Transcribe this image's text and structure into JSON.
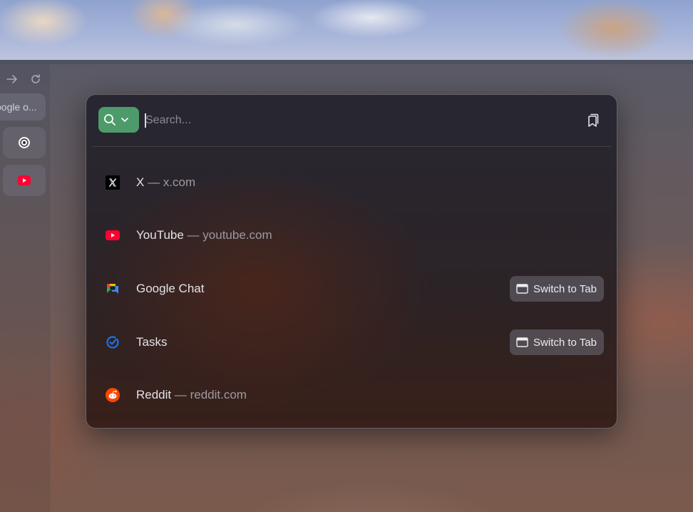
{
  "sidebar": {
    "url_preview": "oogle o...",
    "pinned_tabs": [
      {
        "name": "openai-tab"
      },
      {
        "name": "youtube-tab"
      }
    ]
  },
  "search": {
    "placeholder": "Search..."
  },
  "results": [
    {
      "title": "X",
      "separator": "—",
      "url": "x.com",
      "icon": "x-logo-icon"
    },
    {
      "title": "YouTube",
      "separator": "—",
      "url": "youtube.com",
      "icon": "youtube-icon"
    },
    {
      "title": "Google Chat",
      "action": "Switch to Tab",
      "icon": "google-chat-icon"
    },
    {
      "title": "Tasks",
      "action": "Switch to Tab",
      "icon": "google-tasks-icon"
    },
    {
      "title": "Reddit",
      "separator": "—",
      "url": "reddit.com",
      "icon": "reddit-icon"
    }
  ],
  "colors": {
    "engine_button": "#4d9b6a",
    "youtube_red": "#ff0033",
    "reddit_orange": "#ff4500"
  }
}
